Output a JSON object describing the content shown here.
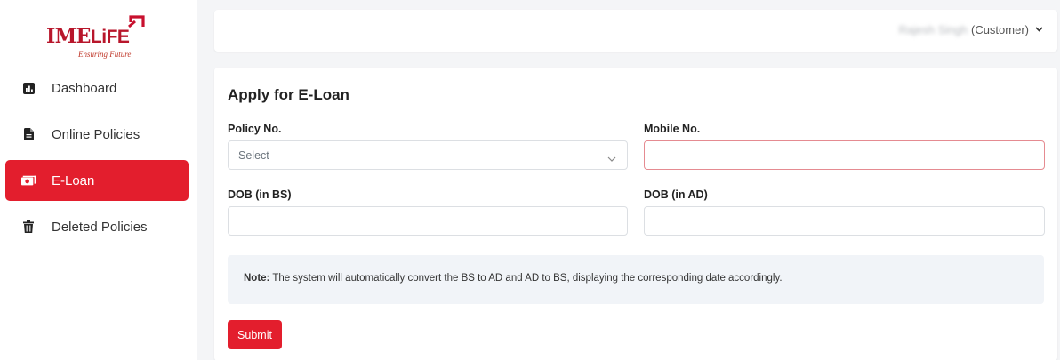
{
  "brand": {
    "logo_text_ime": "IME",
    "logo_text_life": "LiFE",
    "tagline": "Ensuring Future",
    "accent_color": "#e31e2d"
  },
  "sidebar": {
    "items": [
      {
        "label": "Dashboard",
        "icon": "bar-chart-icon",
        "active": false
      },
      {
        "label": "Online Policies",
        "icon": "file-icon",
        "active": false
      },
      {
        "label": "E-Loan",
        "icon": "money-bill-icon",
        "active": true
      },
      {
        "label": "Deleted Policies",
        "icon": "trash-icon",
        "active": false
      }
    ]
  },
  "header": {
    "user_name": "Rajesh Singh",
    "user_role": "(Customer)",
    "chevron_icon": "chevron-down-icon"
  },
  "form": {
    "title": "Apply for E-Loan",
    "policy_label": "Policy No.",
    "policy_placeholder": "Select",
    "mobile_label": "Mobile No.",
    "mobile_value": "",
    "dob_bs_label": "DOB (in BS)",
    "dob_bs_value": "",
    "dob_ad_label": "DOB (in AD)",
    "dob_ad_value": "",
    "note_prefix": "Note:",
    "note_text": " The system will automatically convert the BS to AD and AD to BS, displaying the corresponding date accordingly.",
    "submit_label": "Submit"
  }
}
